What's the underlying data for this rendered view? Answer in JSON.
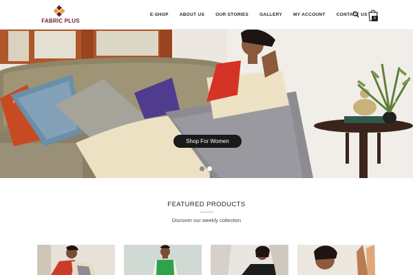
{
  "header": {
    "logo_text": "FABRIC PLUS",
    "nav": [
      "E-SHOP",
      "ABOUT US",
      "OUR STORIES",
      "GALLERY",
      "MY ACCOUNT",
      "CONTACT US"
    ],
    "search_icon": "search-icon",
    "cart_icon": "shopping-bag-icon",
    "cart_count": "0"
  },
  "hero": {
    "button_label": "Shop For Women",
    "active_slide": 2,
    "slide_count": 2,
    "prev_arrow": "‹",
    "next_arrow": "›"
  },
  "featured": {
    "title": "FEATURED PRODUCTS",
    "subtitle": "Discover our weekly collection"
  },
  "colors": {
    "brand": "#6a1b3a",
    "logo_gold": "#e2a219",
    "button_bg": "#1a1a1a"
  }
}
